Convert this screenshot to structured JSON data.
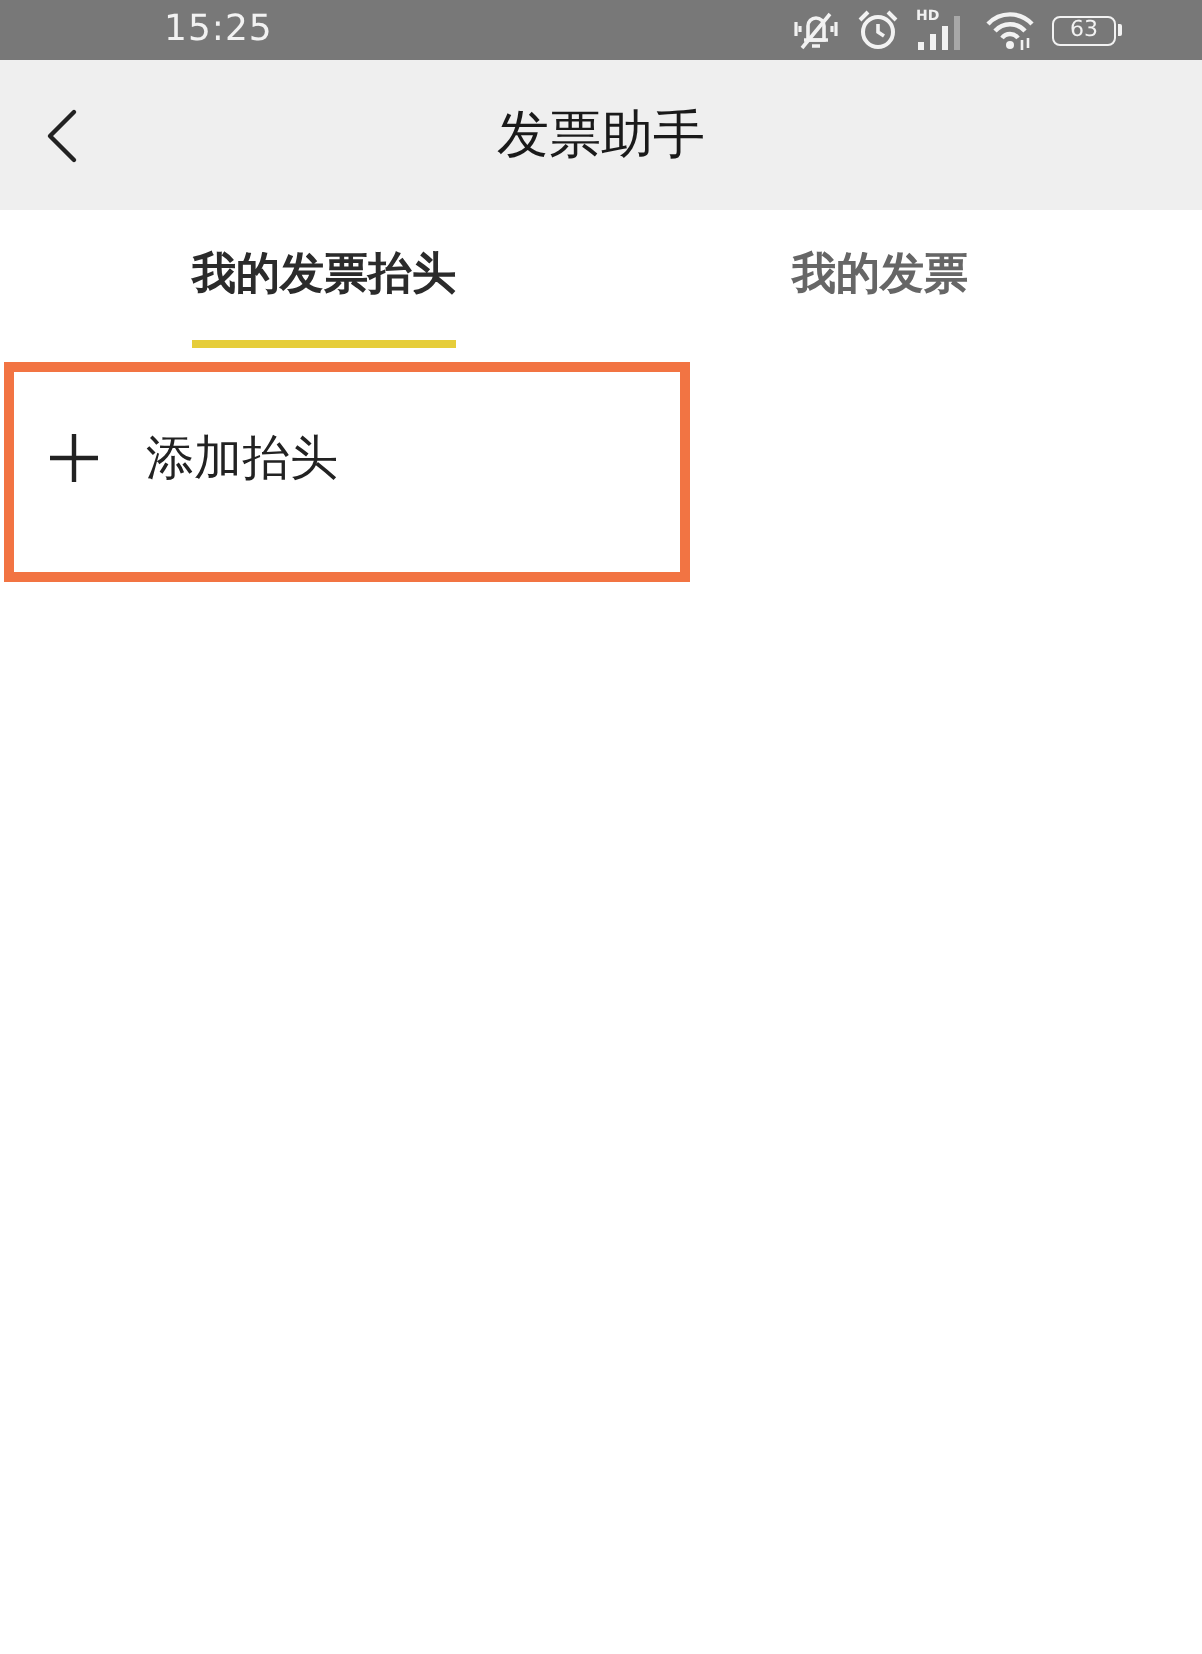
{
  "status_bar": {
    "time": "15:25",
    "network_label": "HD",
    "battery": "63"
  },
  "header": {
    "title": "发票助手"
  },
  "tabs": [
    {
      "label": "我的发票抬头",
      "selected": true
    },
    {
      "label": "我的发票",
      "selected": false
    }
  ],
  "add_header": {
    "label": "添加抬头",
    "highlighted": true
  }
}
